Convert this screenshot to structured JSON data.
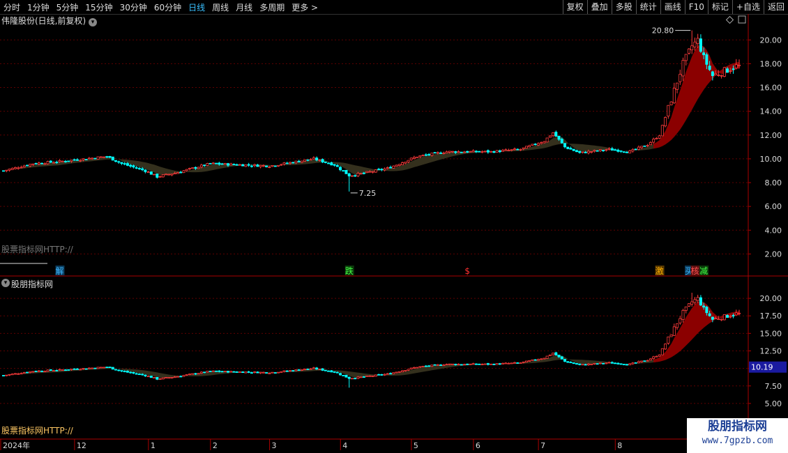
{
  "toolbar": {
    "periods": [
      "分时",
      "1分钟",
      "5分钟",
      "15分钟",
      "30分钟",
      "60分钟",
      "日线",
      "周线",
      "月线",
      "多周期",
      "更多 >"
    ],
    "active_period": "日线",
    "buttons": [
      "复权",
      "叠加",
      "多股",
      "统计",
      "画线",
      "F10",
      "标记",
      "+自选",
      "返回"
    ]
  },
  "pane1": {
    "title": "伟隆股份(日线,前复权)",
    "watermark": "股票指标网HTTP://",
    "high_label": "20.80",
    "low_label": "7.25",
    "signals": [
      {
        "text": "解",
        "color": "#3fb8ff",
        "bg": "#0a3a5a",
        "date_index": 19
      },
      {
        "text": "跌",
        "color": "#45ff45",
        "bg": "#0b3b0b",
        "date_index": 117
      },
      {
        "text": "$",
        "color": "#ff3030",
        "bg": "#000",
        "date_index": 157
      },
      {
        "text": "激",
        "color": "#ffb000",
        "bg": "#5a3a00",
        "date_index": 222
      },
      {
        "text": "买",
        "color": "#3fb8ff",
        "bg": "#0a3a5a",
        "date_index": 232
      },
      {
        "text": "核",
        "color": "#ff5050",
        "bg": "#5a1010",
        "date_index": 234
      },
      {
        "text": "减",
        "color": "#45ff45",
        "bg": "#0b3b0b",
        "date_index": 237
      }
    ]
  },
  "pane2": {
    "title": "股朋指标网",
    "watermark": "股票指标网HTTP://",
    "price_tag": "10.19"
  },
  "x_axis": {
    "labels": [
      {
        "text": "2024年",
        "i": 0
      },
      {
        "text": "12",
        "i": 25
      },
      {
        "text": "1",
        "i": 50
      },
      {
        "text": "2",
        "i": 71
      },
      {
        "text": "3",
        "i": 91
      },
      {
        "text": "4",
        "i": 115
      },
      {
        "text": "5",
        "i": 139
      },
      {
        "text": "6",
        "i": 160
      },
      {
        "text": "7",
        "i": 182
      },
      {
        "text": "8",
        "i": 208
      }
    ]
  },
  "logo": {
    "line1": "股朋指标网",
    "line2": "www.7gpzb.com"
  },
  "colors": {
    "up": "#ff3b3b",
    "down": "#00ffff",
    "band": "#3a3520",
    "red_band": "#8b0000",
    "grid": "#600000"
  },
  "chart_data": [
    {
      "type": "candlestick",
      "title": "伟隆股份(日线,前复权)",
      "y_ticks": [
        2.0,
        4.0,
        6.0,
        8.0,
        10.0,
        12.0,
        14.0,
        16.0,
        18.0,
        20.0
      ],
      "ylim": [
        0.5,
        21.6
      ],
      "y_tick_labels": [
        "2.00",
        "4.00",
        "6.00",
        "8.00",
        "10.00",
        "12.00",
        "14.00",
        "16.00",
        "18.00",
        "20.00"
      ],
      "anchors": [
        [
          0,
          9.0
        ],
        [
          10,
          9.6
        ],
        [
          20,
          9.8
        ],
        [
          35,
          10.2
        ],
        [
          40,
          9.6
        ],
        [
          48,
          9.0
        ],
        [
          52,
          8.5
        ],
        [
          58,
          8.8
        ],
        [
          70,
          9.6
        ],
        [
          90,
          9.4
        ],
        [
          105,
          10.0
        ],
        [
          112,
          9.5
        ],
        [
          117,
          8.6
        ],
        [
          120,
          8.7
        ],
        [
          130,
          9.2
        ],
        [
          140,
          10.2
        ],
        [
          150,
          10.6
        ],
        [
          165,
          10.6
        ],
        [
          175,
          10.8
        ],
        [
          183,
          11.5
        ],
        [
          186,
          12.2
        ],
        [
          190,
          11.0
        ],
        [
          195,
          10.5
        ],
        [
          205,
          10.8
        ],
        [
          212,
          10.6
        ],
        [
          218,
          11.2
        ],
        [
          222,
          12.0
        ],
        [
          226,
          15.0
        ],
        [
          230,
          18.0
        ],
        [
          233,
          19.5
        ],
        [
          235,
          20.0
        ],
        [
          237,
          18.5
        ],
        [
          240,
          17.0
        ],
        [
          245,
          17.5
        ],
        [
          248,
          17.8
        ]
      ],
      "high": 20.8,
      "low": 7.25
    },
    {
      "type": "candlestick",
      "title": "股朋指标网",
      "y_ticks": [
        5.0,
        7.5,
        10.0,
        12.5,
        15.0,
        17.5,
        20.0
      ],
      "ylim": [
        2.9,
        21.6
      ],
      "y_tick_labels": [
        "5.00",
        "7.50",
        "10.00",
        "12.50",
        "15.00",
        "17.50",
        "20.00"
      ],
      "last_close": 10.19
    }
  ]
}
